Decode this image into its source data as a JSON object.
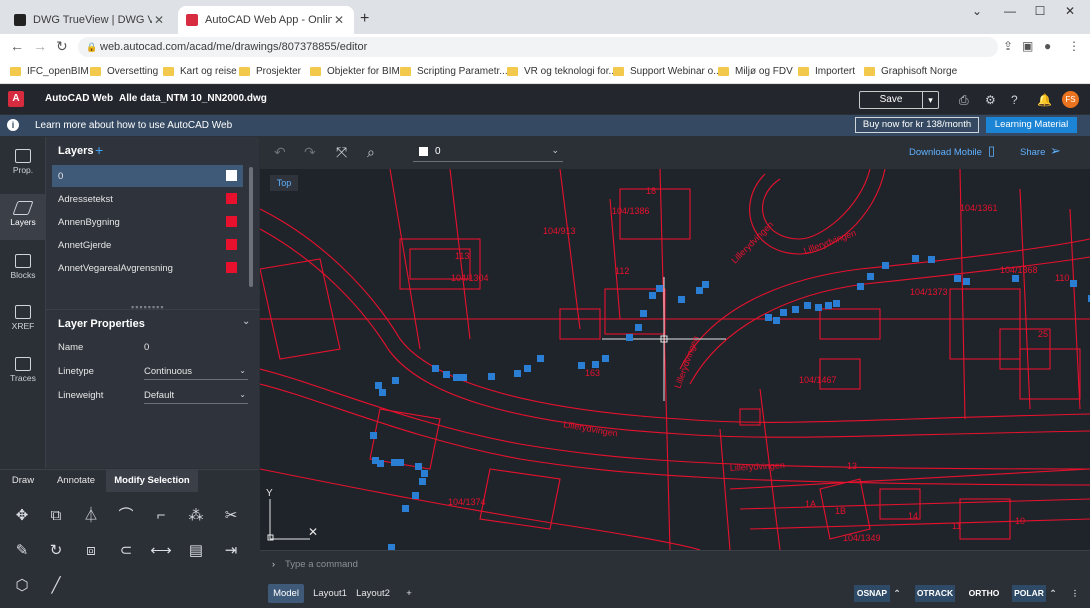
{
  "browser": {
    "tabs": [
      {
        "title": "DWG TrueView | DWG Viewer| A"
      },
      {
        "title": "AutoCAD Web App - Online CAD"
      }
    ],
    "url": "web.autocad.com/acad/me/drawings/807378855/editor",
    "bookmarks": [
      "IFC_openBIM",
      "Oversetting",
      "Kart og reise",
      "Prosjekter",
      "Objekter for BIM",
      "Scripting Parametr...",
      "VR og teknologi for...",
      "Support Webinar o...",
      "Miljø og FDV",
      "Importert",
      "Graphisoft Norge"
    ]
  },
  "app": {
    "name": "AutoCAD Web",
    "file": "Alle data_NTM 10_NN2000.dwg",
    "save_label": "Save",
    "avatar": "FS",
    "brand_color": "#d72b3f"
  },
  "infobar": {
    "text": "Learn more about how to use AutoCAD Web",
    "buy_label": "Buy now for kr 138/month",
    "learning_label": "Learning Material"
  },
  "rail": [
    {
      "label": "Prop."
    },
    {
      "label": "Layers"
    },
    {
      "label": "Blocks"
    },
    {
      "label": "XREF"
    },
    {
      "label": "Traces"
    }
  ],
  "layers": {
    "title": "Layers",
    "items": [
      {
        "name": "0",
        "color": "#ffffff"
      },
      {
        "name": "Adressetekst",
        "color": "#e8112d"
      },
      {
        "name": "AnnenBygning",
        "color": "#e8112d"
      },
      {
        "name": "AnnetGjerde",
        "color": "#e8112d"
      },
      {
        "name": "AnnetVegarealAvgrensning",
        "color": "#e8112d"
      }
    ]
  },
  "layer_properties": {
    "title": "Layer Properties",
    "name_label": "Name",
    "name_value": "0",
    "linetype_label": "Linetype",
    "linetype_value": "Continuous",
    "lineweight_label": "Lineweight",
    "lineweight_value": "Default"
  },
  "tool_tabs": [
    "Draw",
    "Annotate",
    "Modify Selection"
  ],
  "canvas_toolbar": {
    "current_layer": "0",
    "download_mobile": "Download Mobile",
    "share": "Share",
    "view_label": "Top"
  },
  "drawing_labels": [
    "104/1386",
    "104/913",
    "113",
    "104/1304",
    "112",
    "104/1373",
    "104/1368",
    "110",
    "104/1374",
    "104/1349",
    "104/1467",
    "163",
    "Lillerydvingen",
    "Lillerydvingen",
    "Lillerydvingen",
    "Lillerydvingen",
    "Lillerydvingen",
    "18",
    "25",
    "104/1361",
    "13",
    "14",
    "11",
    "10",
    "1A",
    "1B"
  ],
  "command": {
    "placeholder": "Type a command"
  },
  "layouts": [
    "Model",
    "Layout1",
    "Layout2"
  ],
  "status_toggles": [
    "OSNAP",
    "OTRACK",
    "ORTHO",
    "POLAR"
  ]
}
